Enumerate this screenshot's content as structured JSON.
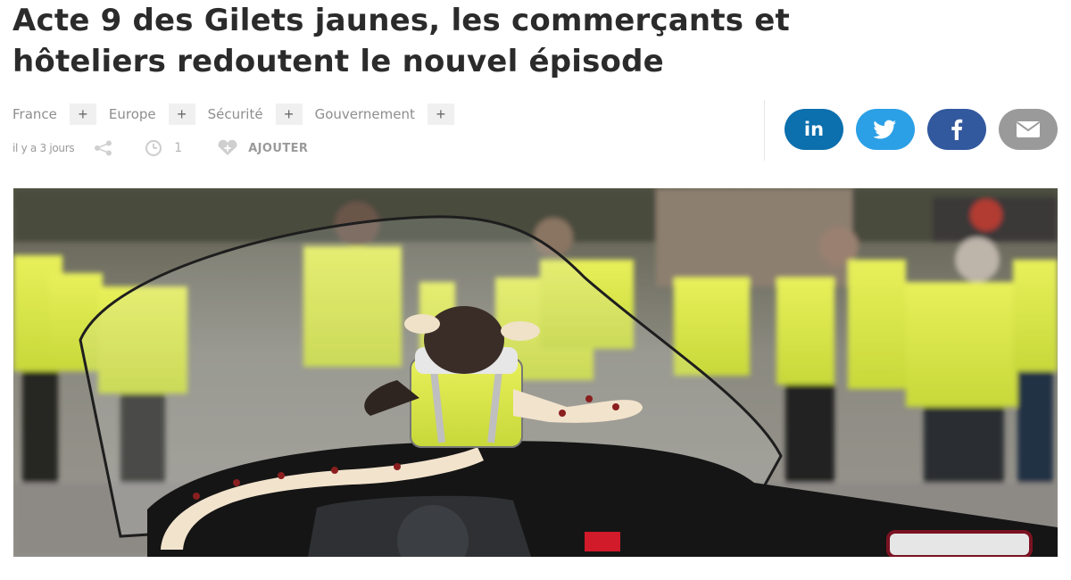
{
  "article": {
    "title_line1": "Acte 9 des Gilets jaunes, les commerçants et",
    "title_line2": "hôteliers redoutent le nouvel épisode"
  },
  "tags": [
    {
      "label": "France"
    },
    {
      "label": "Europe"
    },
    {
      "label": "Sécurité"
    },
    {
      "label": "Gouvernement"
    }
  ],
  "tag_add_symbol": "+",
  "meta": {
    "date": "il y a 3 jours",
    "comment_count": "1",
    "add_label": "AJOUTER"
  },
  "share": {
    "linkedin_label": "in",
    "linkedin_color": "#0c6fae",
    "twitter_color": "#2ba0e6",
    "facebook_color": "#32589e",
    "mail_color": "#9a9a9a"
  },
  "photo": {
    "icon": "photo-gilets-jaunes-motorcycle"
  }
}
